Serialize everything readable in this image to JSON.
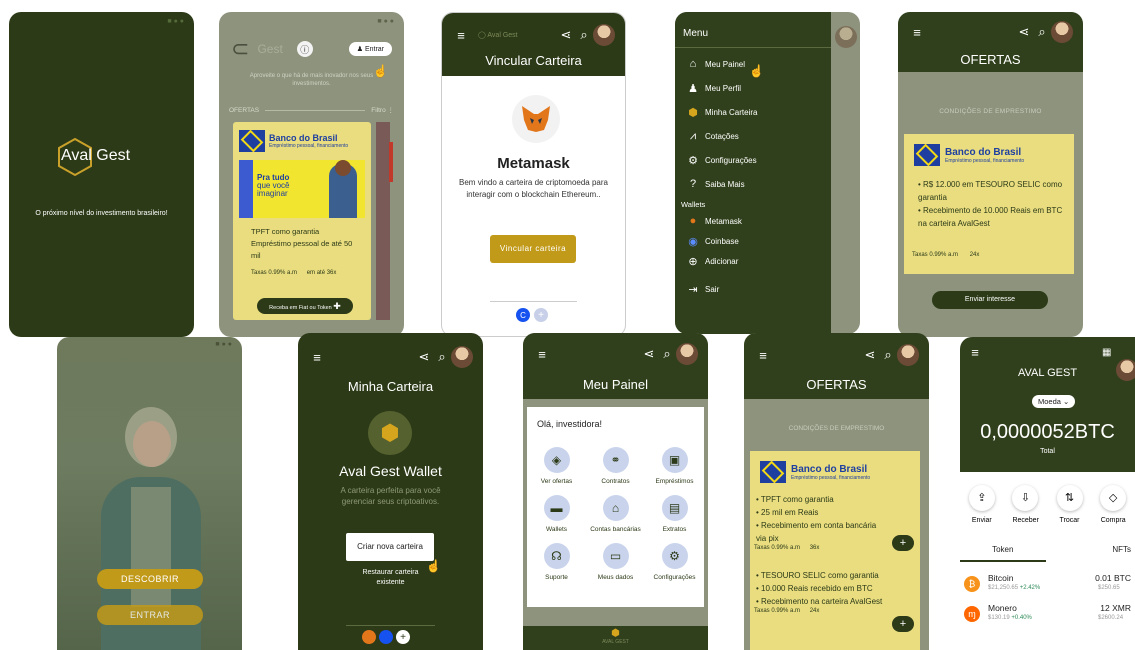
{
  "splash": {
    "brand": "Aval Gest",
    "tagline": "O próximo nível do investimento brasileiro!"
  },
  "offers_preview": {
    "brand": "Gest",
    "login_label": "Entrar",
    "intro": "Aproveite o que há de mais inovador nos seus investimentos.",
    "section": "OFERTAS",
    "filter": "Filtro",
    "bank": "Banco do Brasil",
    "bank_sub": "Empréstimo pessoal, financiamento",
    "promo": [
      "Pra tudo",
      "que você",
      "imaginar"
    ],
    "items": [
      "TPFT como garantia",
      "Empréstimo pessoal de até 50 mil"
    ],
    "fees": "Taxas 0.99% a.m",
    "term": "em até 36x",
    "cta": "Receba em Fiat ou Token"
  },
  "link_wallet": {
    "title": "Vincular Carteira",
    "name": "Metamask",
    "desc": "Bem vindo a carteira de criptomoeda  para interagir com o blockchain Ethereum..",
    "button": "Vincular carteira"
  },
  "menu": {
    "title": "Menu",
    "items": [
      "Meu Painel",
      "Meu Perfil",
      "Minha Carteira",
      "Cotações",
      "Configurações",
      "Saiba Mais"
    ],
    "wallets_label": "Wallets",
    "wallets": [
      "Metamask",
      "Coinbase",
      "Adicionar"
    ],
    "logout": "Sair"
  },
  "offers_top": {
    "title": "OFERTAS",
    "section": "CONDIÇÕES DE EMPRESTIMO",
    "bank": "Banco do Brasil",
    "bank_sub": "Empréstimo pessoal, financiamento",
    "items": [
      "R$ 12.000 em TESOURO SELIC como garantia",
      "Recebimento de 10.000 Reais em BTC na carteira AvalGest"
    ],
    "fees": "Taxas 0.99% a.m",
    "term": "24x",
    "button": "Enviar interesse"
  },
  "welcome": {
    "discover": "DESCOBRIR",
    "enter": "ENTRAR"
  },
  "my_wallet": {
    "title": "Minha Carteira",
    "name": "Aval Gest Wallet",
    "desc": "A carteira perfeita para você gerenciar seus criptoativos.",
    "create": "Criar nova carteira",
    "restore": "Restaurar carteira existente"
  },
  "dashboard": {
    "title": "Meu Painel",
    "greeting": "Olá, investidora!",
    "tiles": [
      "Ver ofertas",
      "Contratos",
      "Empréstimos",
      "Wallets",
      "Contas bancárias",
      "Extratos",
      "Suporte",
      "Meus dados",
      "Configurações"
    ],
    "footer": "AVAL GEST"
  },
  "offers_bottom": {
    "title": "OFERTAS",
    "section": "CONDIÇÕES DE EMPRESTIMO",
    "bank": "Banco do Brasil",
    "bank_sub": "Empréstimo pessoal, financiamento",
    "items1": [
      "TPFT como garantia",
      "25 mil em Reais",
      "Recebimento em conta bancária via pix"
    ],
    "fees1": "Taxas 0.99% a.m",
    "term1": "36x",
    "items2": [
      "TESOURO SELIC como garantia",
      "10.000 Reais recebido em BTC",
      "Recebimento na carteira AvalGest"
    ],
    "fees2": "Taxas 0.99% a.m",
    "term2": "24x"
  },
  "crypto": {
    "title": "AVAL GEST",
    "currency": "Moeda",
    "balance": "0,0000052BTC",
    "total": "Total",
    "actions": [
      "Enviar",
      "Receber",
      "Trocar",
      "Compra"
    ],
    "tabs": [
      "Token",
      "NFTs"
    ],
    "assets": [
      {
        "name": "Bitcoin",
        "price": "$21,250.65",
        "change": "+2.42%",
        "amount": "0.01 BTC",
        "value": "$250.65"
      },
      {
        "name": "Monero",
        "price": "$130.19",
        "change": "+0.40%",
        "amount": "12 XMR",
        "value": "$2600.24"
      }
    ]
  },
  "colors": {
    "brand_dark": "#2c3a17",
    "gold": "#c29a19",
    "yellow_card": "#e9dd80",
    "positive": "#2e8b57"
  }
}
